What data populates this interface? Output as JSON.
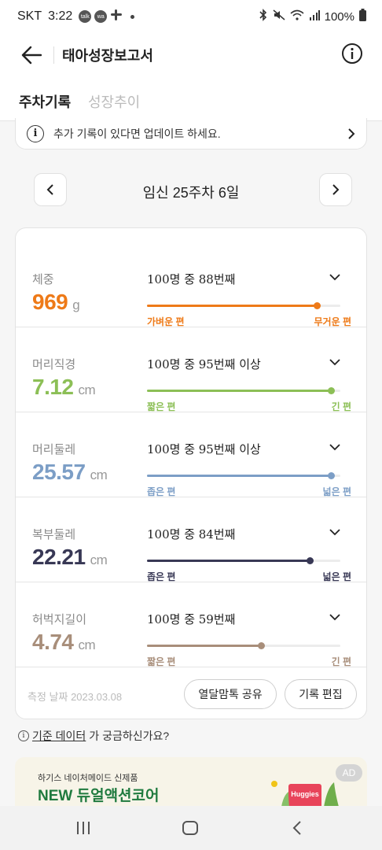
{
  "status_bar": {
    "carrier": "SKT",
    "time": "3:22",
    "notif_1": "talk",
    "notif_2": "wa",
    "notif_3": "slack",
    "battery": "100%"
  },
  "app_bar": {
    "title": "태아성장보고서"
  },
  "tabs": [
    {
      "label": "주차기록",
      "active": true
    },
    {
      "label": "성장추이",
      "active": false
    }
  ],
  "notice": {
    "text": "추가 기록이 있다면 업데이트 하세요."
  },
  "week": {
    "label": "임신 25주차 6일"
  },
  "measurements": [
    {
      "name": "체중",
      "value": "969",
      "unit": "g",
      "rank": "100명 중 88번째",
      "low": "가벼운 편",
      "high": "무거운 편",
      "percent": 88,
      "color": "#ee7a18"
    },
    {
      "name": "머리직경",
      "value": "7.12",
      "unit": "cm",
      "rank": "100명 중 95번째 이상",
      "low": "짧은 편",
      "high": "긴 편",
      "percent": 95,
      "color": "#8cbf56"
    },
    {
      "name": "머리둘레",
      "value": "25.57",
      "unit": "cm",
      "rank": "100명 중 95번째 이상",
      "low": "좁은 편",
      "high": "넓은 편",
      "percent": 95,
      "color": "#7c9ec6"
    },
    {
      "name": "복부둘레",
      "value": "22.21",
      "unit": "cm",
      "rank": "100명 중 84번째",
      "low": "좁은 편",
      "high": "넓은 편",
      "percent": 84,
      "color": "#383855"
    },
    {
      "name": "허벅지길이",
      "value": "4.74",
      "unit": "cm",
      "rank": "100명 중 59번째",
      "low": "짧은 편",
      "high": "긴 편",
      "percent": 59,
      "color": "#a88e7a"
    }
  ],
  "footer": {
    "date": "측정 날짜 2023.03.08",
    "share_label": "열달맘톡 공유",
    "edit_label": "기록 편집"
  },
  "faq": {
    "link": "기준 데이터",
    "rest": "가 궁금하신가요?"
  },
  "ad": {
    "subtitle": "하기스 네이처메이드 신제품",
    "title": "NEW 듀얼액션코어",
    "badge": "AD",
    "brand": "Huggies"
  },
  "colors": {
    "accent_orange": "#ee7a18",
    "accent_green": "#8cbf56",
    "accent_blue": "#7c9ec6",
    "accent_navy": "#383855",
    "accent_taupe": "#a88e7a"
  }
}
